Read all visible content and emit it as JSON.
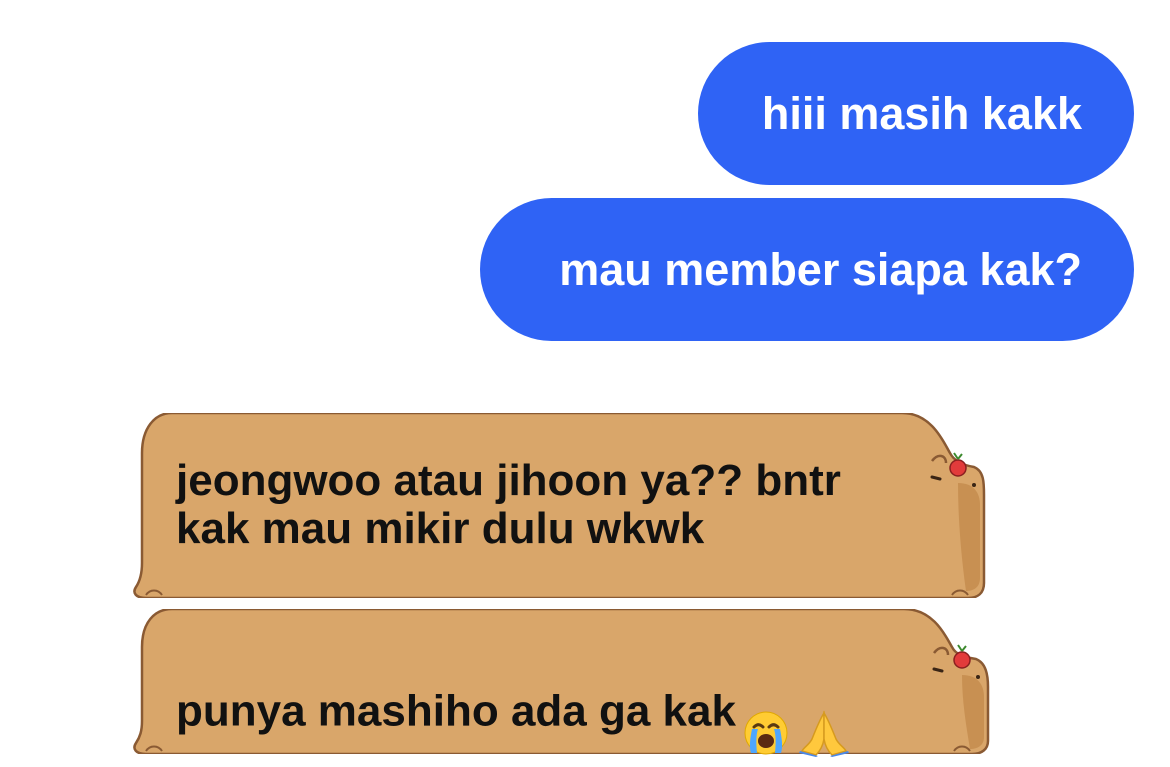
{
  "messages": {
    "outgoing": [
      {
        "text": "hiii masih kakk"
      },
      {
        "text": "mau member siapa kak?"
      }
    ],
    "incoming": [
      {
        "text": "jeongwoo atau jihoon ya?? bntr\nkak mau mikir dulu wkwk"
      },
      {
        "text": "punya mashiho ada ga kak"
      }
    ]
  },
  "icons": {
    "crying_face": "loudly-crying-face-icon",
    "pray": "folded-hands-icon",
    "capybara": "capybara-bubble-decoration-icon"
  },
  "colors": {
    "outgoing_bubble": "#2F63F5",
    "incoming_bubble": "#D9A66A",
    "incoming_outline": "#8A5A33",
    "text_dark": "#111111",
    "text_light": "#FFFFFF"
  }
}
